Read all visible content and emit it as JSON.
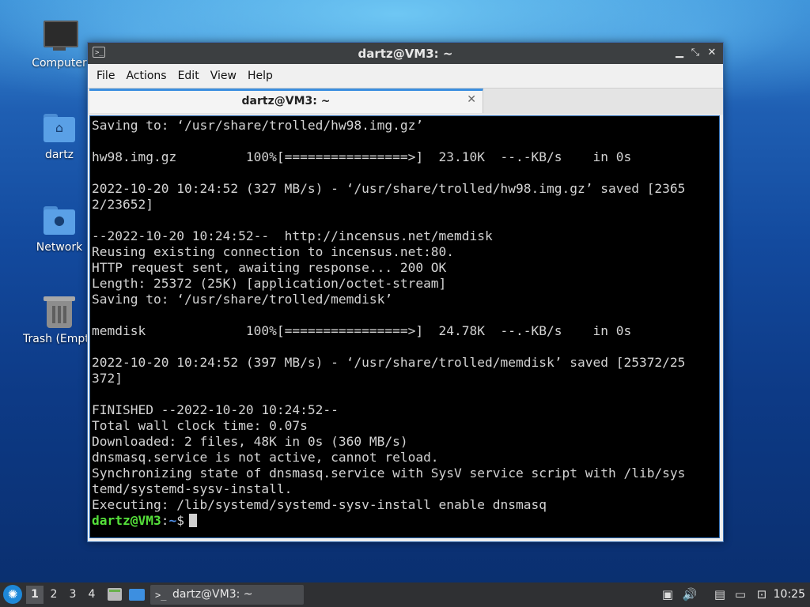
{
  "desktop": {
    "icons": [
      {
        "label": "Computer"
      },
      {
        "label": "dartz"
      },
      {
        "label": "Network"
      },
      {
        "label": "Trash (Empty)"
      }
    ]
  },
  "window": {
    "title": "dartz@VM3: ~",
    "menu": [
      "File",
      "Actions",
      "Edit",
      "View",
      "Help"
    ],
    "tab": {
      "label": "dartz@VM3: ~"
    },
    "terminal_lines": [
      "Saving to: ‘/usr/share/trolled/hw98.img.gz’",
      "",
      "hw98.img.gz         100%[================>]  23.10K  --.-KB/s    in 0s",
      "",
      "2022-10-20 10:24:52 (327 MB/s) - ‘/usr/share/trolled/hw98.img.gz’ saved [2365",
      "2/23652]",
      "",
      "--2022-10-20 10:24:52--  http://incensus.net/memdisk",
      "Reusing existing connection to incensus.net:80.",
      "HTTP request sent, awaiting response... 200 OK",
      "Length: 25372 (25K) [application/octet-stream]",
      "Saving to: ‘/usr/share/trolled/memdisk’",
      "",
      "memdisk             100%[================>]  24.78K  --.-KB/s    in 0s",
      "",
      "2022-10-20 10:24:52 (397 MB/s) - ‘/usr/share/trolled/memdisk’ saved [25372/25",
      "372]",
      "",
      "FINISHED --2022-10-20 10:24:52--",
      "Total wall clock time: 0.07s",
      "Downloaded: 2 files, 48K in 0s (360 MB/s)",
      "dnsmasq.service is not active, cannot reload.",
      "Synchronizing state of dnsmasq.service with SysV service script with /lib/sys",
      "temd/systemd-sysv-install.",
      "Executing: /lib/systemd/systemd-sysv-install enable dnsmasq"
    ],
    "prompt": {
      "user_host": "dartz@VM3",
      "sep": ":",
      "path": "~",
      "symbol": "$"
    }
  },
  "taskbar": {
    "workspaces": [
      "1",
      "2",
      "3",
      "4"
    ],
    "active_workspace": "1",
    "task_label": "dartz@VM3: ~",
    "clock": "10:25"
  },
  "colors": {
    "prompt_user": "#55e03a",
    "prompt_path": "#4f8fe8",
    "accent": "#3c8fe0"
  }
}
